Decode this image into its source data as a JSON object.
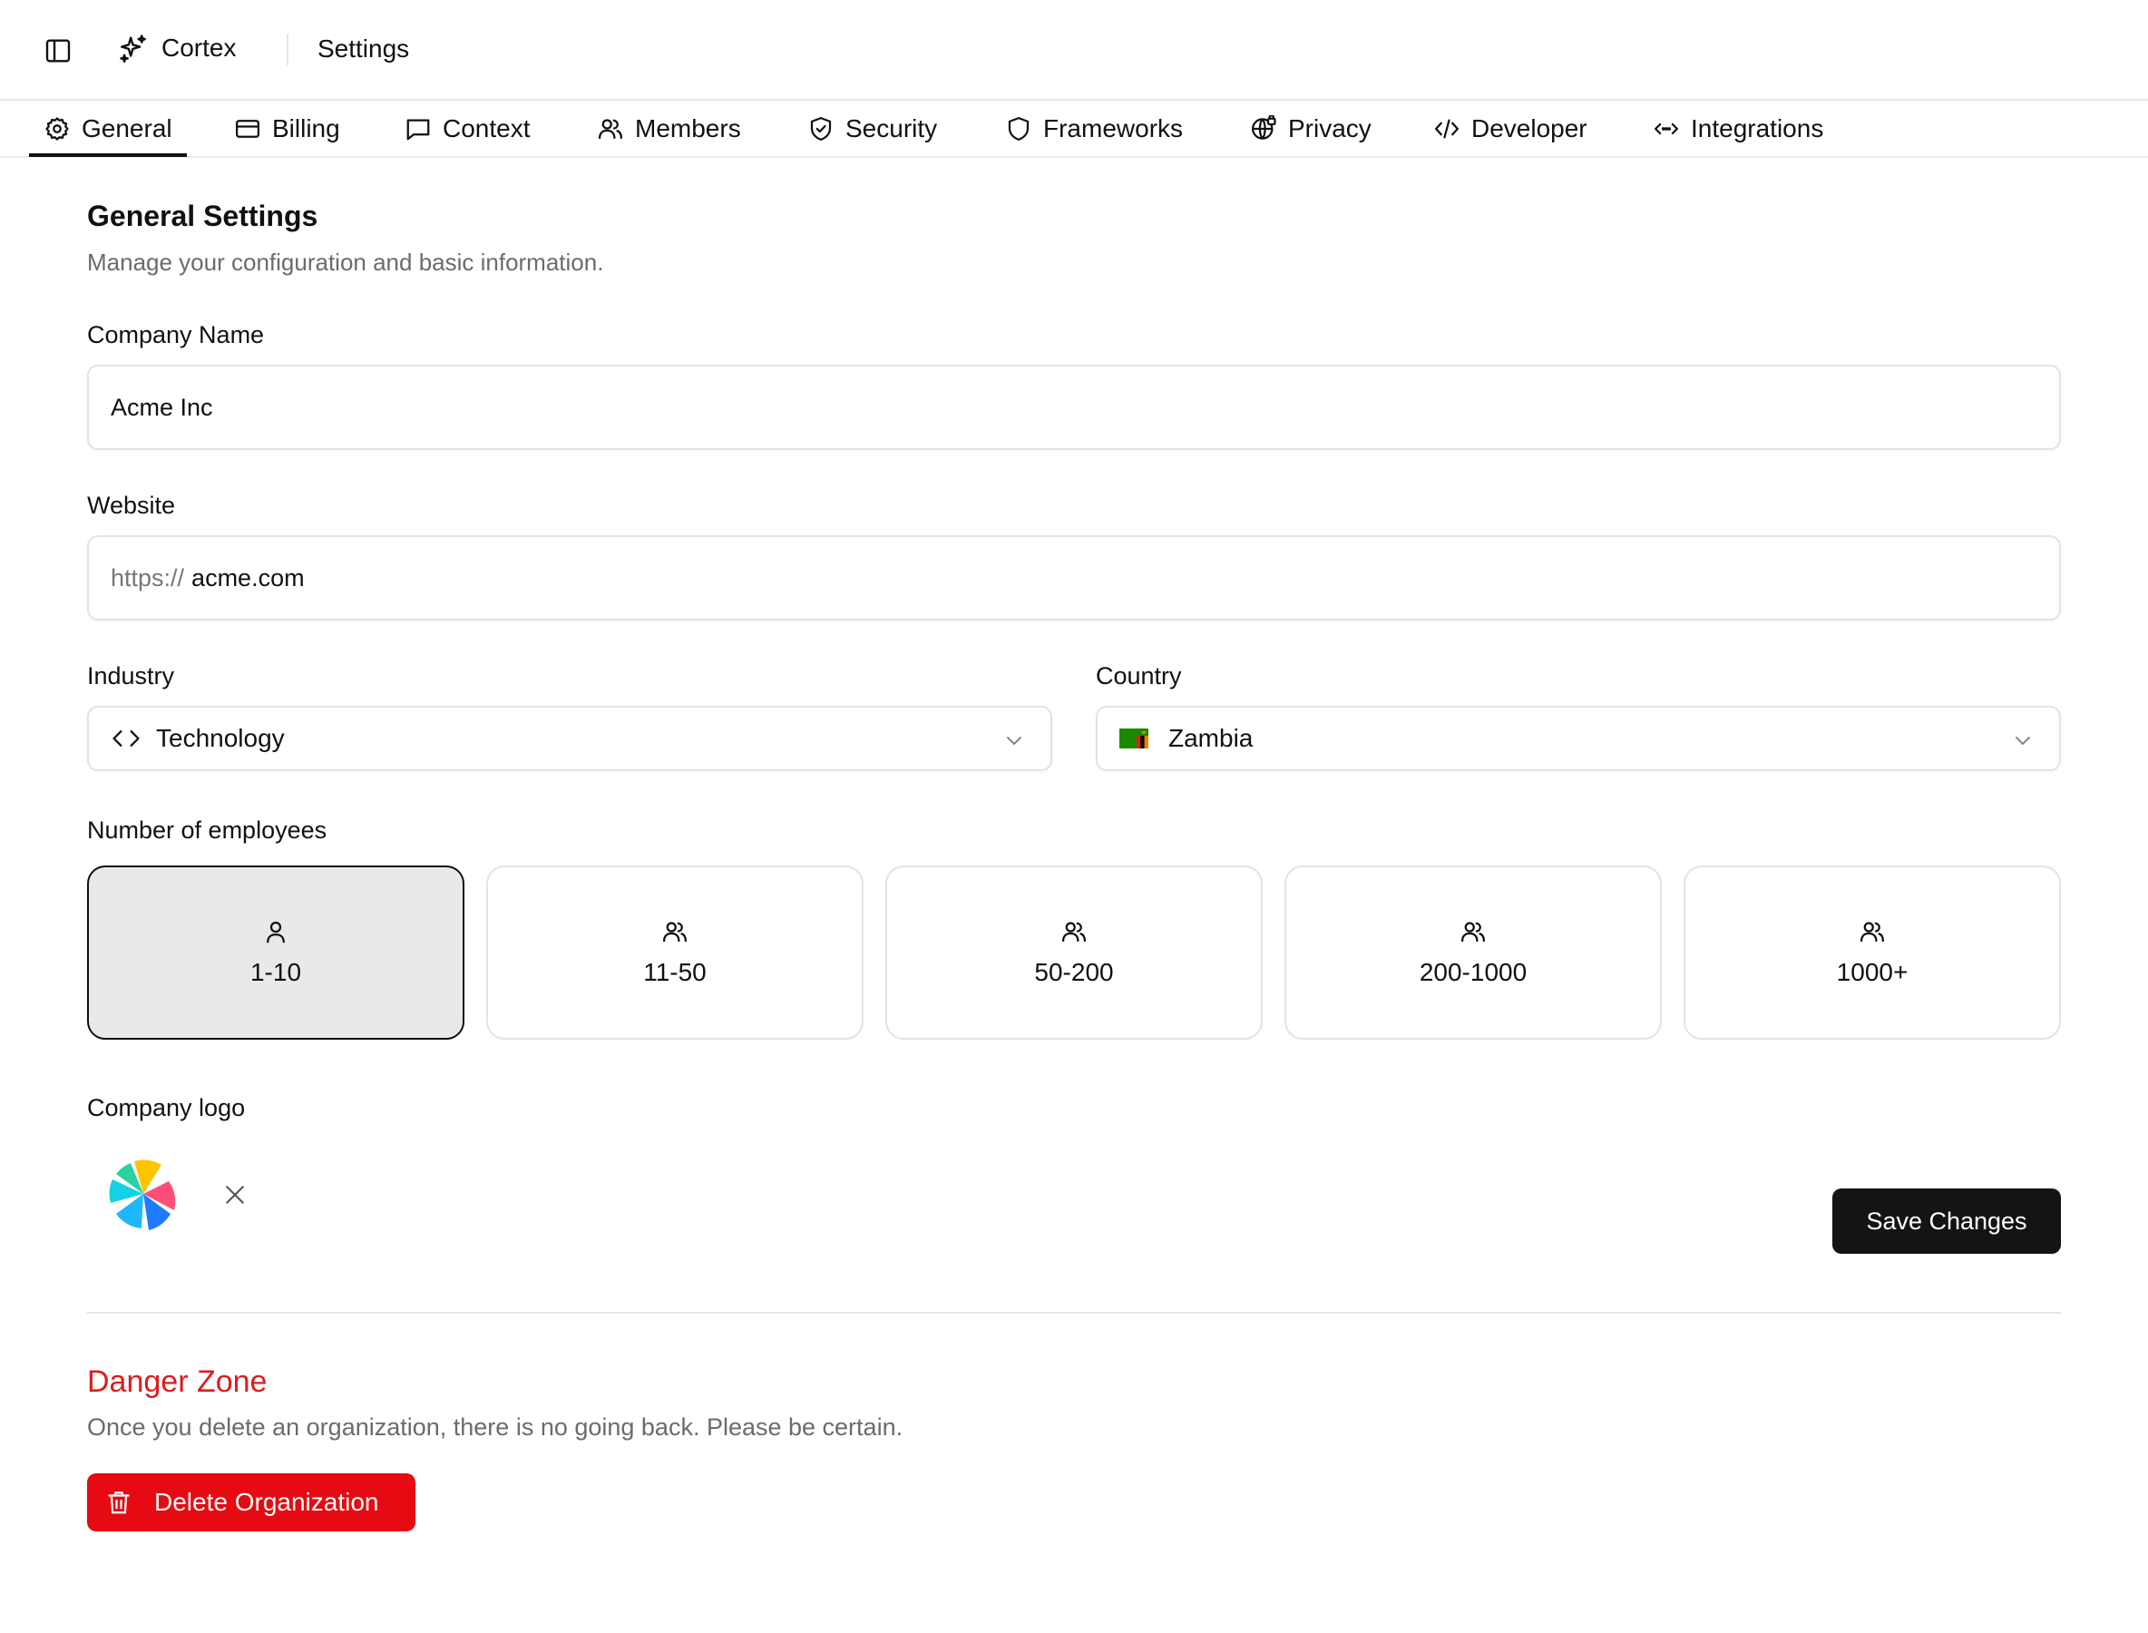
{
  "header": {
    "app_name": "Cortex",
    "page_title": "Settings"
  },
  "tabs": [
    {
      "label": "General",
      "icon": "gear-icon",
      "active": true
    },
    {
      "label": "Billing",
      "icon": "credit-card-icon"
    },
    {
      "label": "Context",
      "icon": "message-square-icon"
    },
    {
      "label": "Members",
      "icon": "users-icon"
    },
    {
      "label": "Security",
      "icon": "shield-check-icon"
    },
    {
      "label": "Frameworks",
      "icon": "shield-icon"
    },
    {
      "label": "Privacy",
      "icon": "globe-lock-icon"
    },
    {
      "label": "Developer",
      "icon": "code-icon"
    },
    {
      "label": "Integrations",
      "icon": "code-arrows-icon"
    }
  ],
  "general": {
    "title": "General Settings",
    "description": "Manage your configuration and basic information.",
    "company_name_label": "Company Name",
    "company_name_value": "Acme Inc",
    "website_label": "Website",
    "website_prefix": "https://",
    "website_value": "acme.com",
    "industry_label": "Industry",
    "industry_value": "Technology",
    "country_label": "Country",
    "country_value": "Zambia",
    "employees_label": "Number of employees",
    "employee_options": [
      "1-10",
      "11-50",
      "50-200",
      "200-1000",
      "1000+"
    ],
    "employee_selected": "1-10",
    "logo_label": "Company logo",
    "save_label": "Save Changes"
  },
  "danger": {
    "title": "Danger Zone",
    "description": "Once you delete an organization, there is no going back. Please be certain.",
    "delete_label": "Delete Organization"
  },
  "colors": {
    "accent": "#141414",
    "danger": "#e60b12",
    "danger_text": "#dc1d1d",
    "selected_card_bg": "#e9e9e9"
  }
}
